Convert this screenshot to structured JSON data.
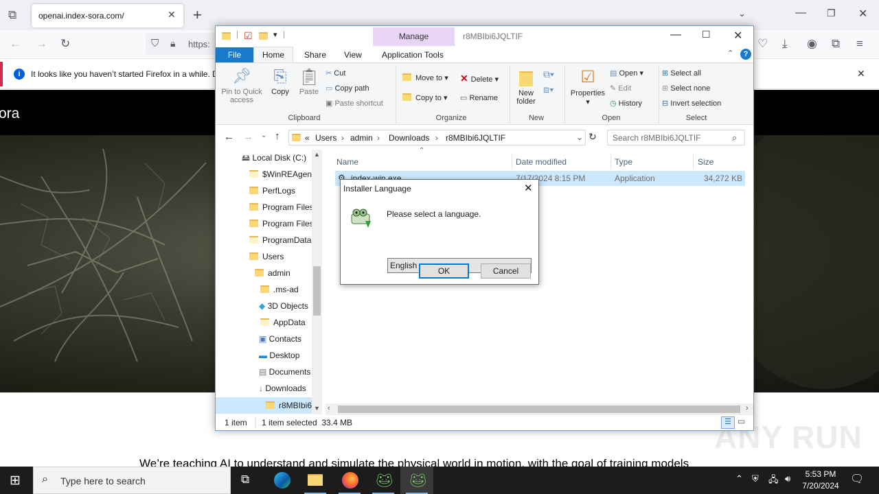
{
  "browser": {
    "tab_title": "openai.index-sora.com/",
    "tab_close": "✕",
    "new_tab": "+",
    "url_partial": "https:",
    "notification_text": "It looks like you haven’t started Firefox in a while. D",
    "notification_close": "✕"
  },
  "page": {
    "logo_text": "ora",
    "tagline": "We’re teaching AI to understand and simulate the physical world in motion, with the goal of training models"
  },
  "explorer": {
    "window_title": "r8MBIbi6JQLTIF",
    "manage_label": "Manage",
    "tabs": [
      "File",
      "Home",
      "Share",
      "View",
      "Application Tools"
    ],
    "ribbon": {
      "clipboard": {
        "label": "Clipboard",
        "pin": "Pin to Quick access",
        "copy": "Copy",
        "paste": "Paste",
        "cut": "Cut",
        "copy_path": "Copy path",
        "paste_shortcut": "Paste shortcut"
      },
      "organize": {
        "label": "Organize",
        "move_to": "Move to",
        "copy_to": "Copy to",
        "delete": "Delete",
        "rename": "Rename"
      },
      "new": {
        "label": "New",
        "new_folder": "New folder"
      },
      "open": {
        "label": "Open",
        "properties": "Properties",
        "open": "Open",
        "edit": "Edit",
        "history": "History"
      },
      "select": {
        "label": "Select",
        "select_all": "Select all",
        "select_none": "Select none",
        "invert": "Invert selection"
      }
    },
    "breadcrumb": [
      "«",
      "Users",
      "admin",
      "Downloads",
      "r8MBIbi6JQLTIF"
    ],
    "search_placeholder": "Search r8MBIbi6JQLTIF",
    "nav_items": [
      "Local Disk (C:)",
      "$WinREAgent",
      "PerfLogs",
      "Program Files",
      "Program Files",
      "ProgramData",
      "Users",
      "admin",
      ".ms-ad",
      "3D Objects",
      "AppData",
      "Contacts",
      "Desktop",
      "Documents",
      "Downloads",
      "r8MBIbi6"
    ],
    "columns": {
      "name": "Name",
      "date": "Date modified",
      "type": "Type",
      "size": "Size"
    },
    "file": {
      "name": "index-win.exe",
      "date": "7/17/2024 8:15 PM",
      "type": "Application",
      "size": "34,272 KB"
    },
    "status": {
      "count": "1 item",
      "selected": "1 item selected  33.4 MB"
    }
  },
  "dialog": {
    "title": "Installer Language",
    "message": "Please select a language.",
    "selected_language": "English",
    "ok": "OK",
    "cancel": "Cancel"
  },
  "taskbar": {
    "search_placeholder": "Type here to search",
    "time": "5:53 PM",
    "date": "7/20/2024"
  },
  "watermark": "ANY RUN"
}
